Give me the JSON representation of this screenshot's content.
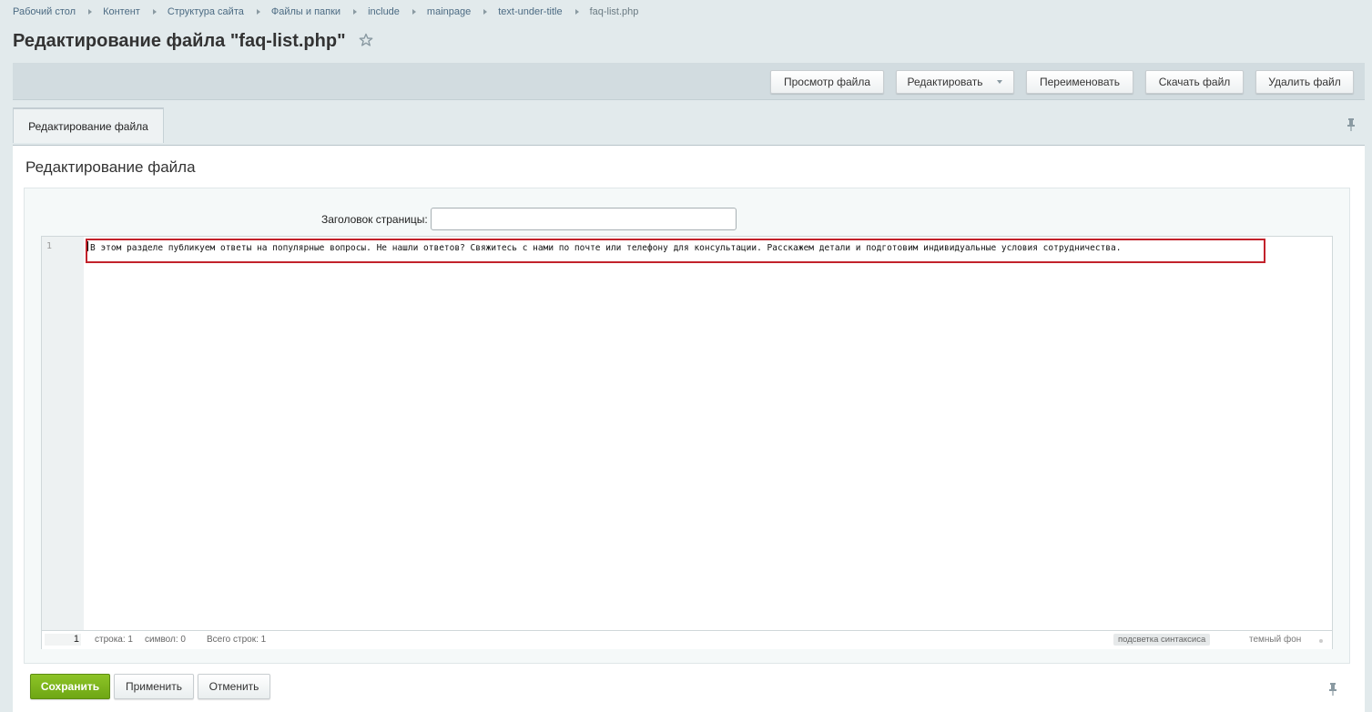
{
  "breadcrumb": [
    "Рабочий стол",
    "Контент",
    "Структура сайта",
    "Файлы и папки",
    "include",
    "mainpage",
    "text-under-title",
    "faq-list.php"
  ],
  "page_title": "Редактирование файла \"faq-list.php\"",
  "toolbar": {
    "view": "Просмотр файла",
    "edit": "Редактировать",
    "rename": "Переименовать",
    "download": "Скачать файл",
    "delete": "Удалить файл"
  },
  "tab": {
    "label": "Редактирование файла"
  },
  "section_title": "Редактирование файла",
  "form": {
    "page_title_label": "Заголовок страницы:",
    "page_title_value": ""
  },
  "editor": {
    "line_number": "1",
    "code": "В этом разделе публикуем ответы на популярные вопросы. Не нашли ответов? Свяжитесь с нами по почте или телефону для консультации. Расскажем детали и подготовим индивидуальные условия сотрудничества.",
    "status": {
      "current_line": "1",
      "row": "строка: 1",
      "col": "символ: 0",
      "total": "Всего строк: 1",
      "syntax": "подсветка синтаксиса",
      "dark": "темный фон"
    }
  },
  "buttons": {
    "save": "Сохранить",
    "apply": "Применить",
    "cancel": "Отменить"
  },
  "colors": {
    "accent_green": "#76b01a",
    "highlight_red": "#c2222b",
    "link": "#4c6b83"
  },
  "icons": [
    "star-icon",
    "pin-icon",
    "chevron-right-icon",
    "caret-down-icon"
  ]
}
